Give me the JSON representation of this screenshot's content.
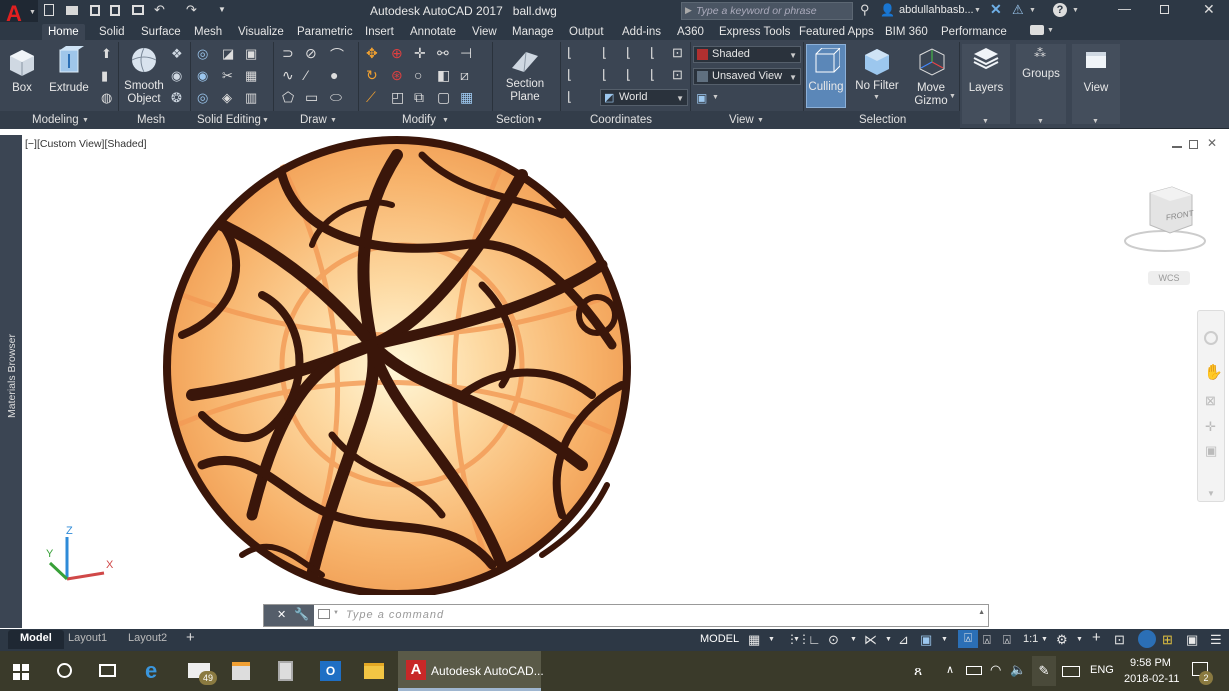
{
  "app": {
    "title": "Autodesk AutoCAD 2017",
    "filename": "ball.dwg",
    "search_placeholder": "Type a keyword or phrase",
    "user": "abdullahbasb..."
  },
  "ribbon_tabs": [
    "Home",
    "Solid",
    "Surface",
    "Mesh",
    "Visualize",
    "Parametric",
    "Insert",
    "Annotate",
    "View",
    "Manage",
    "Output",
    "Add-ins",
    "A360",
    "Express Tools",
    "Featured Apps",
    "BIM 360",
    "Performance"
  ],
  "ribbon": {
    "box": "Box",
    "extrude": "Extrude",
    "smooth_object": "Smooth Object",
    "section_plane": "Section Plane",
    "visual_style": "Shaded",
    "saved_view": "Unsaved View",
    "ucs": "World",
    "culling": "Culling",
    "no_filter": "No Filter",
    "move_gizmo": "Move Gizmo",
    "layers": "Layers",
    "groups": "Groups",
    "view": "View",
    "panels": {
      "modeling": "Modeling",
      "mesh": "Mesh",
      "solid_editing": "Solid Editing",
      "draw": "Draw",
      "modify": "Modify",
      "section": "Section",
      "coordinates": "Coordinates",
      "view": "View",
      "selection": "Selection"
    }
  },
  "viewport": {
    "label": "[−][Custom View][Shaded]",
    "viewcube_face": "FRONT",
    "wcs": "WCS",
    "axis_z": "Z",
    "axis_x": "X",
    "axis_y": "Y"
  },
  "sidebar": {
    "materials_browser": "Materials Browser"
  },
  "command": {
    "placeholder": "Type a command"
  },
  "layout_tabs": [
    "Model",
    "Layout1",
    "Layout2"
  ],
  "status": {
    "model": "MODEL",
    "scale": "1:1"
  },
  "taskbar": {
    "app_label": "Autodesk AutoCAD...",
    "mail_badge": "49",
    "lang": "ENG",
    "time": "9:58 PM",
    "date": "2018-02-11",
    "notif_badge": "2"
  },
  "colors": {
    "accent": "#2b6fb6",
    "title_bg": "#2d3845",
    "ribbon_bg": "#3b4553",
    "sphere_dark": "#3a160a",
    "sphere_light": "#f7b26a"
  }
}
